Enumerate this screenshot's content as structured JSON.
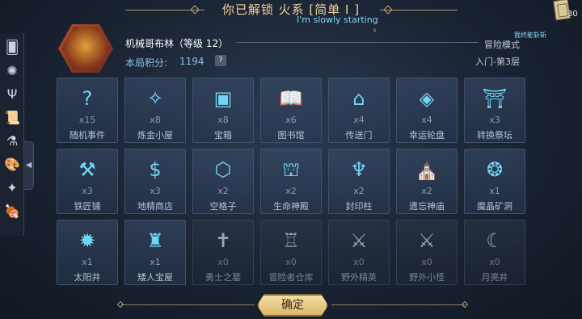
{
  "header": {
    "title": "你已解锁 火系 [简单 I ]",
    "subtitle": "I'm slowly starting",
    "small_mark": "s",
    "corner_number": "30"
  },
  "sidebar": {
    "items": [
      {
        "icon": "cards-icon",
        "glyph": "🂠"
      },
      {
        "icon": "spiked-ring-icon",
        "glyph": "✺"
      },
      {
        "icon": "slingshot-icon",
        "glyph": "Ψ"
      },
      {
        "icon": "scroll-icon",
        "glyph": "📜"
      },
      {
        "icon": "potion-icon",
        "glyph": "⚗"
      },
      {
        "icon": "palette-icon",
        "glyph": "🎨"
      },
      {
        "icon": "sparkle-icon",
        "glyph": "✦"
      },
      {
        "icon": "meat-icon",
        "glyph": "🍖"
      }
    ],
    "toggle": "◀"
  },
  "character": {
    "name": "机械哥布林（等级 12）",
    "score_label": "本局积分:",
    "score_value": "1194",
    "help": "?",
    "mode_tag": "我终能斩斩",
    "mode": "冒险模式",
    "floor": "入门-第3层"
  },
  "grid": [
    {
      "label": "随机事件",
      "count": "x15",
      "icon": "question-icon",
      "glyph": "?",
      "dim": false
    },
    {
      "label": "炼金小屋",
      "count": "x8",
      "icon": "alchemy-icon",
      "glyph": "✧",
      "dim": false
    },
    {
      "label": "宝箱",
      "count": "x8",
      "icon": "chest-icon",
      "glyph": "▣",
      "dim": false
    },
    {
      "label": "图书馆",
      "count": "x6",
      "icon": "book-icon",
      "glyph": "📖",
      "dim": false
    },
    {
      "label": "传送门",
      "count": "x4",
      "icon": "portal-icon",
      "glyph": "⌂",
      "dim": false
    },
    {
      "label": "幸运轮盘",
      "count": "x4",
      "icon": "wheel-icon",
      "glyph": "◈",
      "dim": false
    },
    {
      "label": "转换祭坛",
      "count": "x3",
      "icon": "altar-icon",
      "glyph": "⛩",
      "dim": false
    },
    {
      "label": "铁匠铺",
      "count": "x3",
      "icon": "anvil-icon",
      "glyph": "⚒",
      "dim": false
    },
    {
      "label": "地精商店",
      "count": "x3",
      "icon": "shop-icon",
      "glyph": "$",
      "dim": false
    },
    {
      "label": "空格子",
      "count": "x2",
      "icon": "hexagon-icon",
      "glyph": "⬡",
      "dim": false
    },
    {
      "label": "生命神殿",
      "count": "x2",
      "icon": "temple-icon",
      "glyph": "⛫",
      "dim": false
    },
    {
      "label": "封印柱",
      "count": "x2",
      "icon": "seal-icon",
      "glyph": "♆",
      "dim": false
    },
    {
      "label": "遗忘神庙",
      "count": "x2",
      "icon": "shrine-icon",
      "glyph": "⛪",
      "dim": false
    },
    {
      "label": "魔晶矿洞",
      "count": "x1",
      "icon": "crystal-mine-icon",
      "glyph": "❂",
      "dim": false
    },
    {
      "label": "太阳井",
      "count": "x1",
      "icon": "sun-well-icon",
      "glyph": "✹",
      "dim": false
    },
    {
      "label": "矮人宝屋",
      "count": "x1",
      "icon": "dwarf-house-icon",
      "glyph": "♜",
      "dim": false
    },
    {
      "label": "勇士之墓",
      "count": "x0",
      "icon": "tomb-icon",
      "glyph": "✝",
      "dim": true
    },
    {
      "label": "冒险者仓库",
      "count": "x0",
      "icon": "warehouse-icon",
      "glyph": "♖",
      "dim": true
    },
    {
      "label": "野外精英",
      "count": "x0",
      "icon": "elite-icon",
      "glyph": "⚔",
      "dim": true
    },
    {
      "label": "野外小怪",
      "count": "x0",
      "icon": "monster-icon",
      "glyph": "⚔",
      "dim": true
    },
    {
      "label": "月亮井",
      "count": "x0",
      "icon": "moon-well-icon",
      "glyph": "☾",
      "dim": true
    }
  ],
  "footer": {
    "confirm": "确定"
  }
}
